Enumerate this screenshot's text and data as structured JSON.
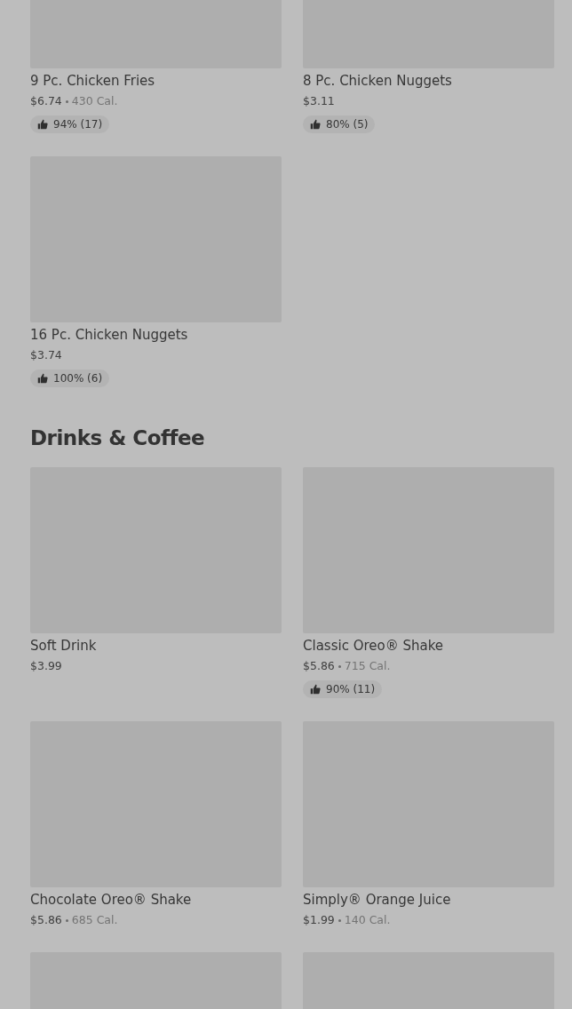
{
  "sections": [
    {
      "items": [
        {
          "kind": "item",
          "name": "9 Pc. Chicken Fries",
          "price": "$6.74",
          "calories": "430 Cal.",
          "rating": "94% (17)"
        },
        {
          "kind": "item",
          "name": "8 Pc. Chicken Nuggets",
          "price": "$3.11",
          "rating": "80% (5)"
        },
        {
          "kind": "item",
          "name": "16 Pc. Chicken Nuggets",
          "price": "$3.74",
          "rating": "100% (6)"
        }
      ]
    },
    {
      "title": "Drinks & Coffee",
      "items": [
        {
          "kind": "item",
          "name": "Soft Drink",
          "price": "$3.99"
        },
        {
          "kind": "item",
          "name": "Classic Oreo® Shake",
          "price": "$5.86",
          "calories": "715 Cal.",
          "rating": "90% (11)"
        },
        {
          "kind": "item",
          "name": "Chocolate Oreo® Shake",
          "price": "$5.86",
          "calories": "685 Cal."
        },
        {
          "kind": "item",
          "name": "Simply® Orange Juice",
          "price": "$1.99",
          "calories": "140 Cal."
        },
        {
          "kind": "image_only"
        },
        {
          "kind": "image_only"
        }
      ]
    }
  ]
}
